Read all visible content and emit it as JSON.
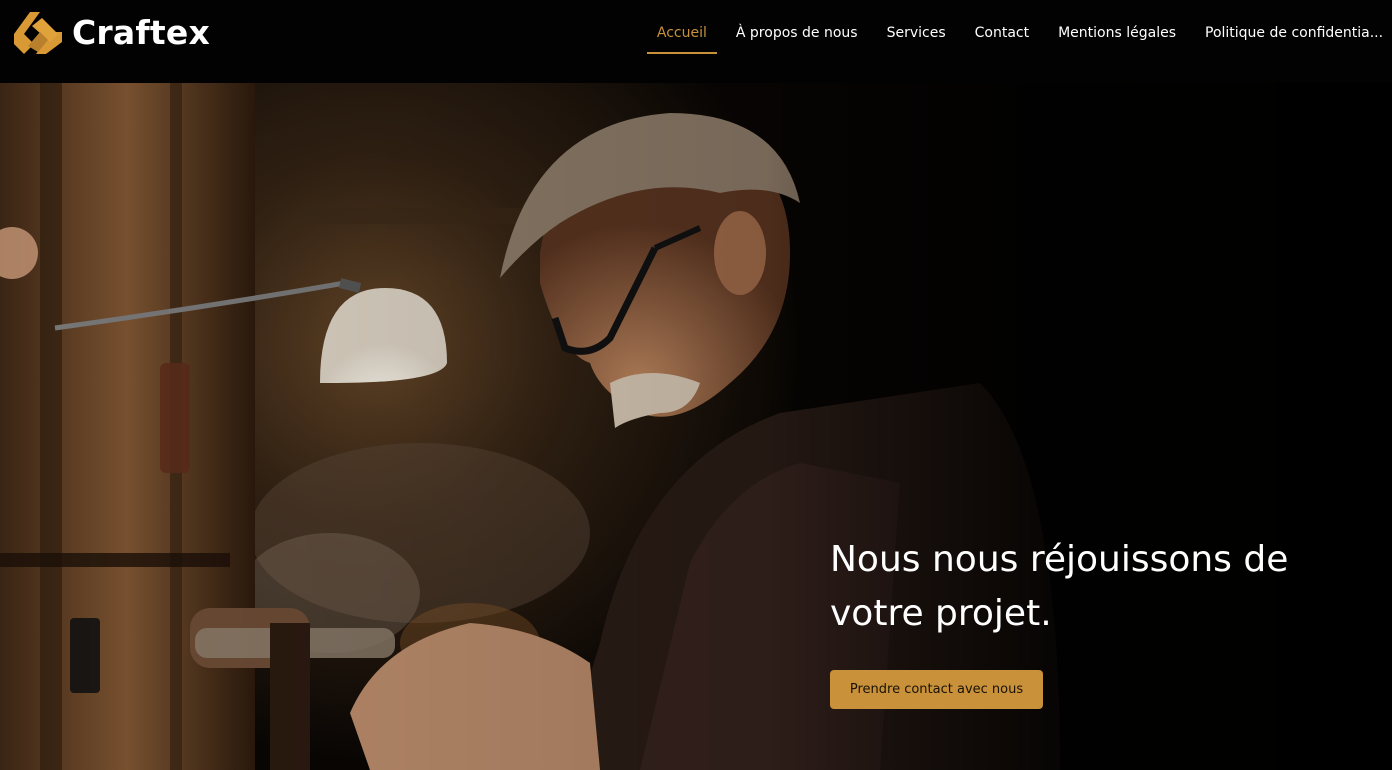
{
  "brand": {
    "name": "Craftex",
    "accent_color": "#c8913a",
    "logo_icon": "craftex-chevron-logo"
  },
  "nav": {
    "items": [
      {
        "label": "Accueil",
        "active": true
      },
      {
        "label": "À propos de nous",
        "active": false
      },
      {
        "label": "Services",
        "active": false
      },
      {
        "label": "Contact",
        "active": false
      },
      {
        "label": "Mentions légales",
        "active": false
      },
      {
        "label": "Politique de confidentia...",
        "active": false
      }
    ]
  },
  "hero": {
    "headline_line1": "Nous nous réjouissons de",
    "headline_line2": "votre projet.",
    "cta_label": "Prendre contact avec nous",
    "image_subject": "old craftsman with glasses working at a workbench under a lamp"
  }
}
